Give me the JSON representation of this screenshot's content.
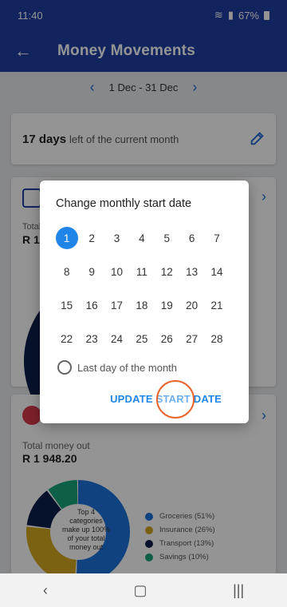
{
  "status_bar": {
    "time": "11:40",
    "battery": "67%"
  },
  "app_bar": {
    "title": "Money Movements"
  },
  "date_range": {
    "label": "1 Dec - 31 Dec"
  },
  "days_card": {
    "count": "17 days",
    "rest": "left of the current month"
  },
  "money_in_card": {
    "label": "Total",
    "amount": "R 1"
  },
  "money_out_card": {
    "label": "Total money out",
    "amount": "R 1 948.20",
    "center_text_1": "Top 4",
    "center_text_2": "categories",
    "center_text_3": "make up 100%",
    "center_text_4": "of your total",
    "center_text_5": "money out",
    "legend": [
      {
        "label": "Groceries (51%)",
        "color": "#1a73d9",
        "value": 51
      },
      {
        "label": "Insurance (26%)",
        "color": "#d4a820",
        "value": 26
      },
      {
        "label": "Transport (13%)",
        "color": "#0c1e4a",
        "value": 13
      },
      {
        "label": "Savings (10%)",
        "color": "#17a67a",
        "value": 10
      }
    ]
  },
  "dialog": {
    "title": "Change monthly start date",
    "selected_day": 1,
    "days": [
      "1",
      "2",
      "3",
      "4",
      "5",
      "6",
      "7",
      "8",
      "9",
      "10",
      "11",
      "12",
      "13",
      "14",
      "15",
      "16",
      "17",
      "18",
      "19",
      "20",
      "21",
      "22",
      "23",
      "24",
      "25",
      "26",
      "27",
      "28"
    ],
    "last_day_label": "Last day of the month",
    "update_label": "UPDATE START DATE"
  },
  "colors": {
    "primary": "#1f3fa3",
    "accent": "#1f86e8"
  }
}
